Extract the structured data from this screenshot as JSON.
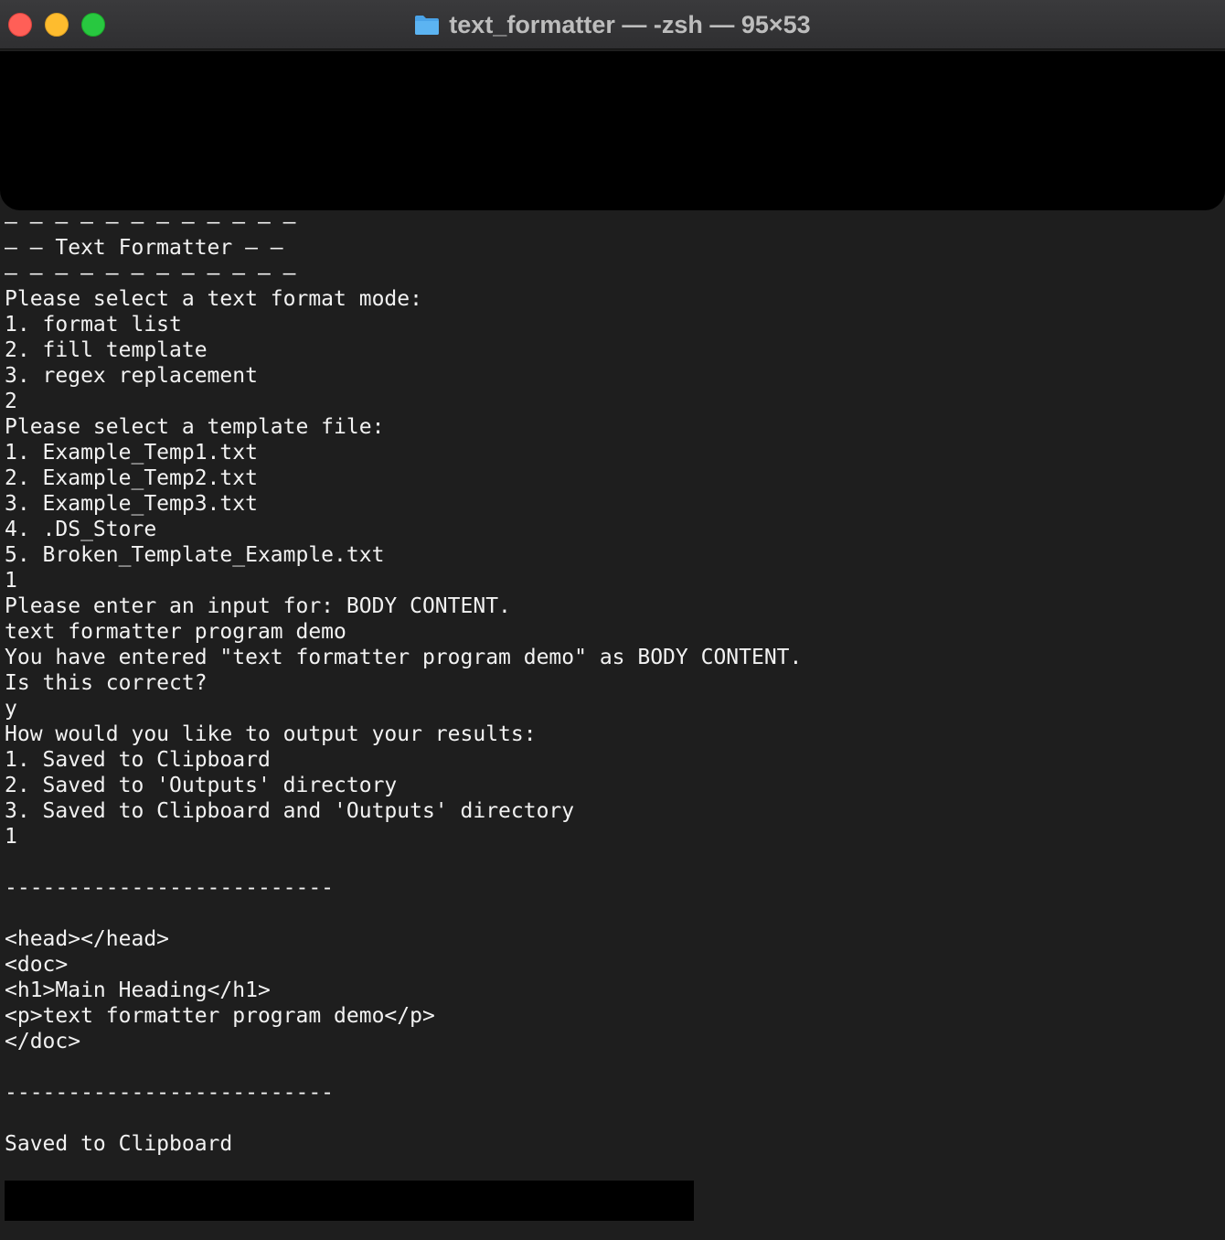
{
  "window": {
    "title": "text_formatter — -zsh — 95×53",
    "icon": "folder-icon"
  },
  "terminal": {
    "lines": [
      "– – – – – – – – – – – –",
      "– – Text Formatter – –",
      "– – – – – – – – – – – –",
      "Please select a text format mode:",
      "1. format list",
      "2. fill template",
      "3. regex replacement",
      "2",
      "Please select a template file:",
      "1. Example_Temp1.txt",
      "2. Example_Temp2.txt",
      "3. Example_Temp3.txt",
      "4. .DS_Store",
      "5. Broken_Template_Example.txt",
      "1",
      "Please enter an input for: BODY CONTENT.",
      "text formatter program demo",
      "You have entered \"text formatter program demo\" as BODY CONTENT.",
      "Is this correct?",
      "y",
      "How would you like to output your results:",
      "1. Saved to Clipboard",
      "2. Saved to 'Outputs' directory",
      "3. Saved to Clipboard and 'Outputs' directory",
      "1",
      "",
      "--------------------------",
      "",
      "<head></head>",
      "<doc>",
      "<h1>Main Heading</h1>",
      "<p>text formatter program demo</p>",
      "</doc>",
      "",
      "--------------------------",
      "",
      "Saved to Clipboard"
    ]
  }
}
